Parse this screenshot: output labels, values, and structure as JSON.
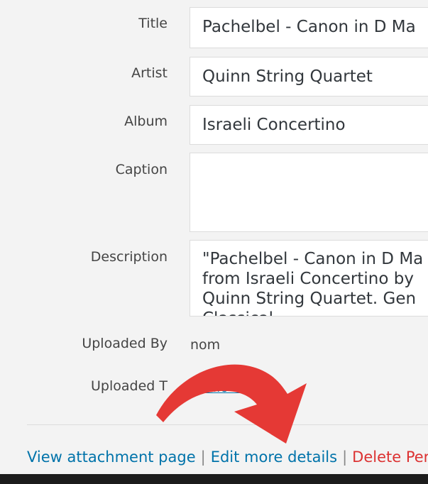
{
  "fields": {
    "title": {
      "label": "Title",
      "value": "Pachelbel - Canon in D Ma"
    },
    "artist": {
      "label": "Artist",
      "value": "Quinn String Quartet"
    },
    "album": {
      "label": "Album",
      "value": "Israeli Concertino"
    },
    "caption": {
      "label": "Caption",
      "value": ""
    },
    "description": {
      "label": "Description",
      "lines": [
        "\"Pachelbel - Canon in D Ma",
        "from Israeli Concertino by",
        "Quinn String Quartet. Gen",
        "Classical"
      ]
    }
  },
  "meta": {
    "uploaded_by_label": "Uploaded By",
    "uploaded_by_value": "nom",
    "uploaded_to_label": "Uploaded T",
    "uploaded_to_value": "Audio Playlist"
  },
  "actions": {
    "view_attachment": "View attachment page",
    "separator": "|",
    "edit_details": "Edit more details",
    "delete": "Delete Per"
  },
  "annotation": {
    "icon": "curved-arrow-icon",
    "color": "#e53935"
  },
  "colors": {
    "link": "#0073aa",
    "danger": "#dc3232",
    "background": "#f3f3f3"
  }
}
